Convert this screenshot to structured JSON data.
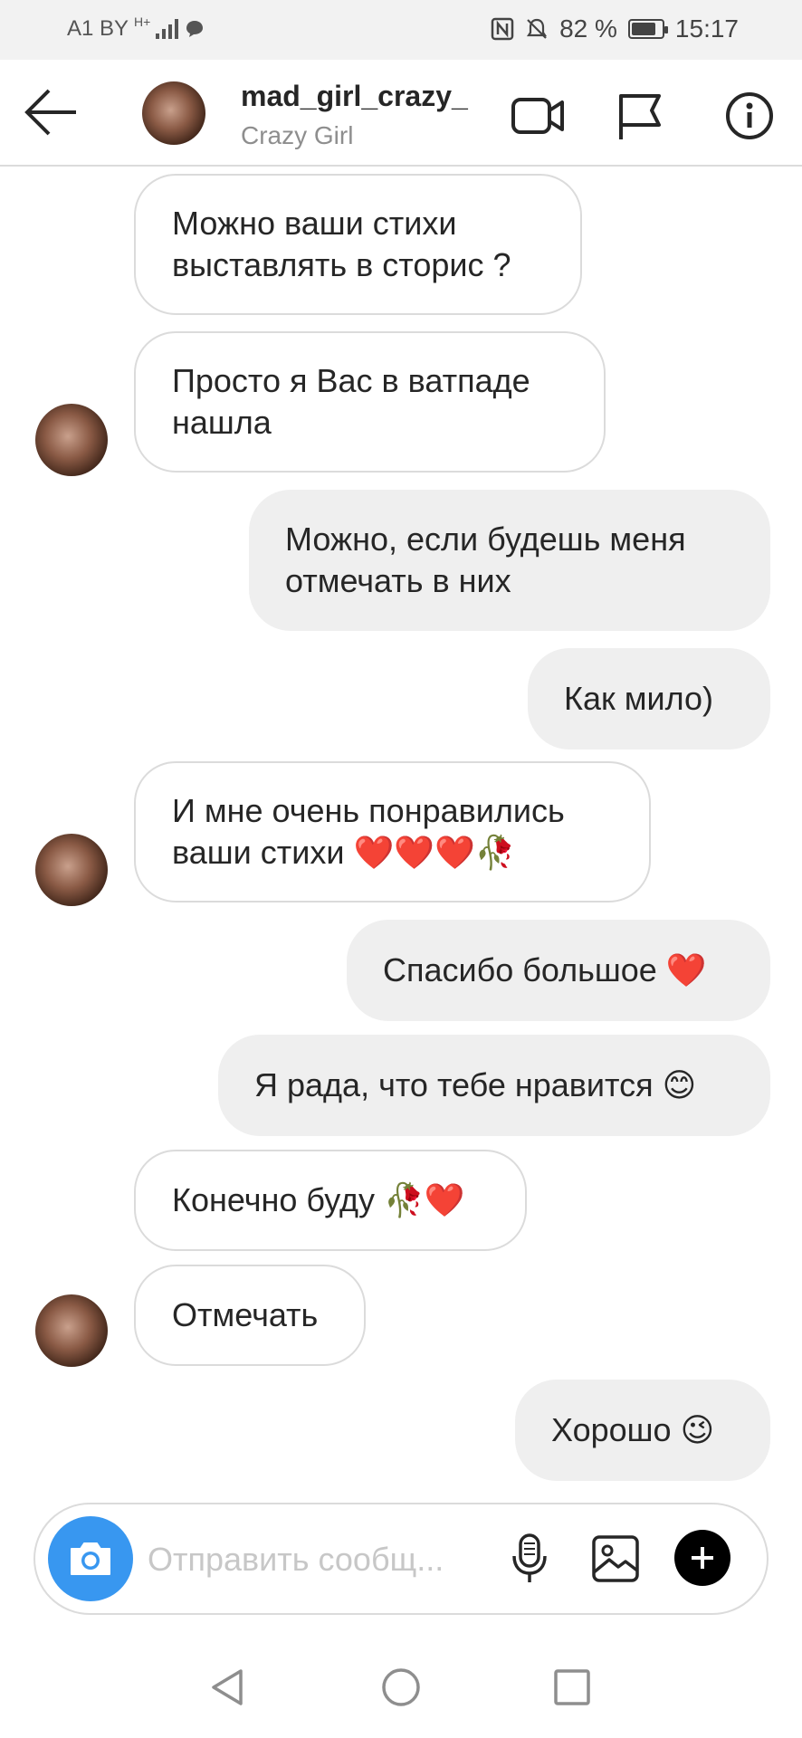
{
  "status_bar": {
    "carrier": "A1 BY",
    "signal_label": "H+",
    "battery": "82 %",
    "battery_level": 0.82,
    "time": "15:17"
  },
  "header": {
    "username": "mad_girl_crazy_",
    "display_name": "Crazy Girl"
  },
  "messages": [
    {
      "side": "in",
      "text": "Можно ваши стихи\nвыставлять в сторис ?"
    },
    {
      "side": "in",
      "text": "Просто я Вас в ватпаде\nнашла"
    },
    {
      "side": "out",
      "text": "Можно, если будешь меня\nотмечать в них"
    },
    {
      "side": "out",
      "text": "Как мило)"
    },
    {
      "side": "in",
      "text": "И мне очень понравились\nваши стихи ❤️❤️❤️🥀"
    },
    {
      "side": "out",
      "text": "Спасибо большое ❤️"
    },
    {
      "side": "out",
      "text": "Я рада, что тебе нравится 😊"
    },
    {
      "side": "in",
      "text": "Конечно буду 🥀❤️"
    },
    {
      "side": "in",
      "text": "Отмечать"
    },
    {
      "side": "out",
      "text": "Хорошо 😉"
    }
  ],
  "composer": {
    "placeholder": "Отправить сообщ..."
  },
  "colors": {
    "accent": "#3897f0",
    "incoming_border": "#dbdbdb",
    "outgoing_bg": "#efefef"
  },
  "icons": {
    "back": "arrow-left-icon",
    "video": "video-camera-icon",
    "flag": "flag-icon",
    "info": "info-icon",
    "camera": "camera-icon",
    "mic": "microphone-icon",
    "gallery": "image-icon",
    "plus": "plus-icon"
  }
}
